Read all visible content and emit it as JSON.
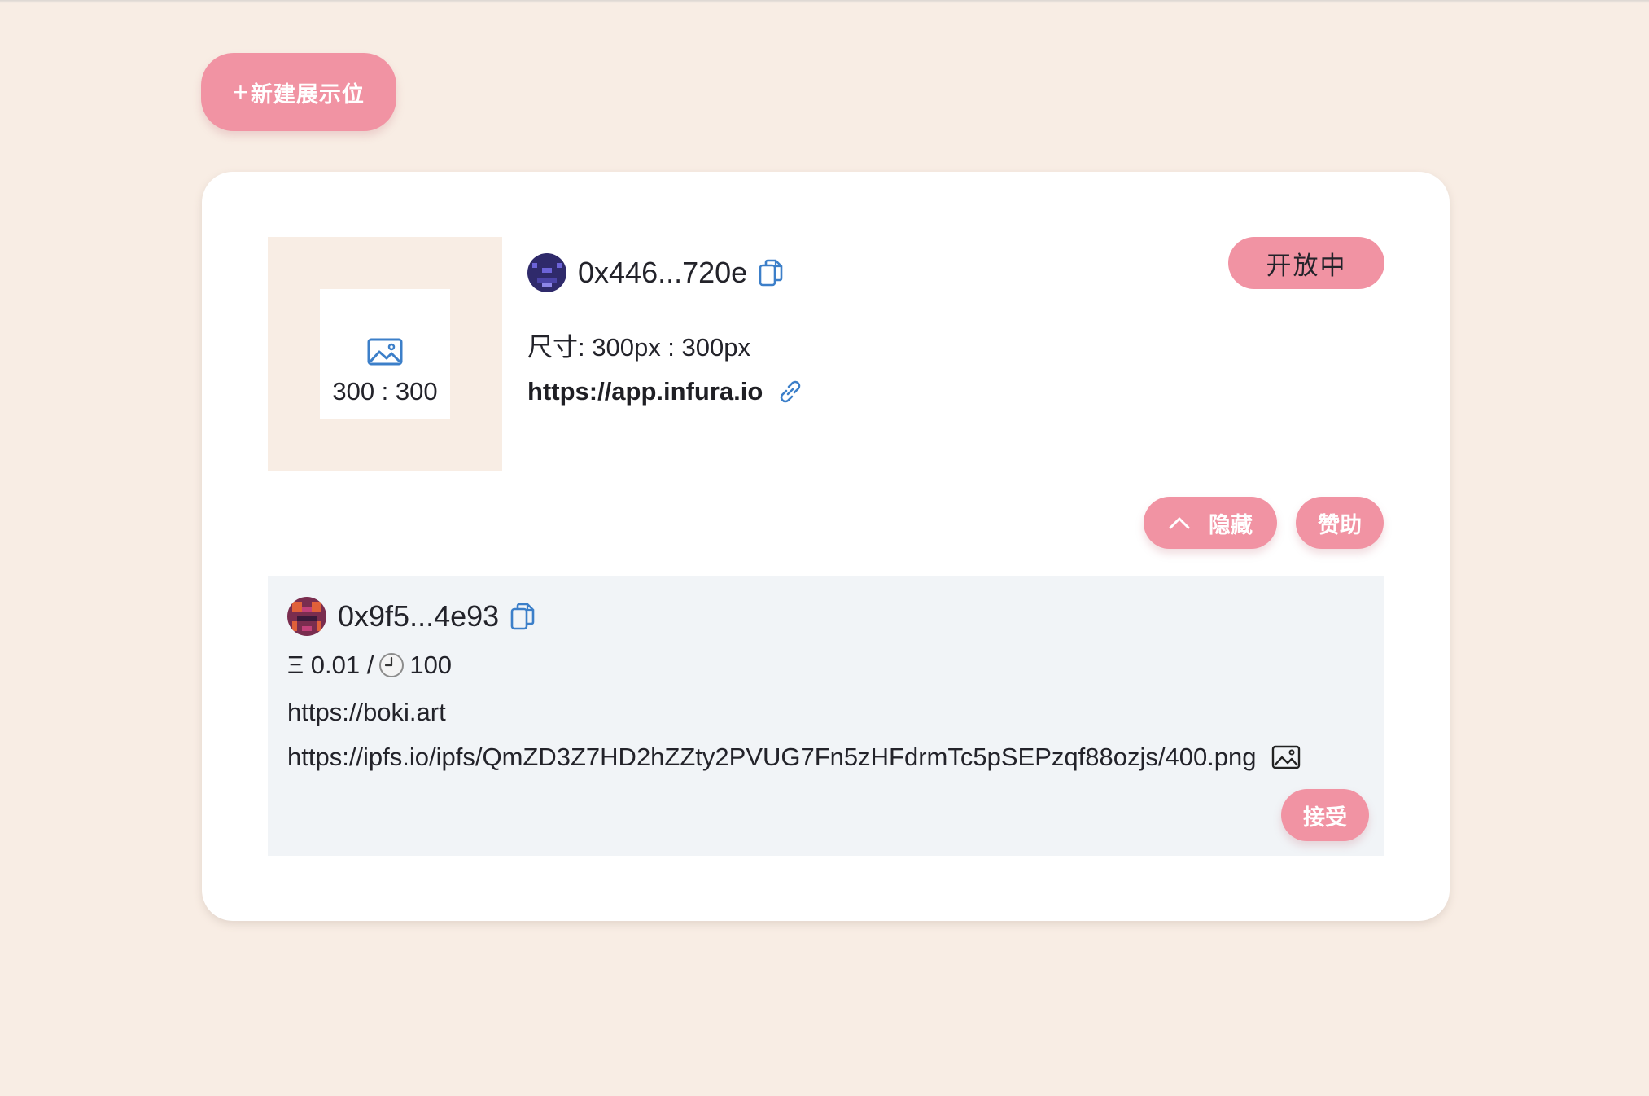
{
  "toolbar": {
    "new_slot_label": "新建展示位",
    "new_slot_icon": "plus-icon"
  },
  "slot": {
    "thumbnail": {
      "ratio_text": "300 : 300",
      "icon": "image-icon"
    },
    "owner": {
      "address": "0x446...720e",
      "avatar": "identicon-avatar",
      "copy_icon": "copy-icon"
    },
    "size_text": "尺寸: 300px : 300px",
    "link": {
      "text": "https://app.infura.io",
      "icon": "link-icon"
    },
    "status": "开放中",
    "actions": {
      "hide_label": "隐藏",
      "hide_icon": "chevron-up-icon",
      "sponsor_label": "赞助"
    }
  },
  "offer": {
    "bidder": {
      "address": "0x9f5...4e93",
      "avatar": "identicon-avatar",
      "copy_icon": "copy-icon"
    },
    "price_prefix": "Ξ 0.01 /",
    "duration": "100",
    "duration_icon": "clock-icon",
    "url": "https://boki.art",
    "image_url": "https://ipfs.io/ipfs/QmZD3Z7HD2hZZty2PVUG7Fn5zHFdrmTc5pSEPzqf88ozjs/400.png",
    "image_icon": "image-icon",
    "accept_label": "接受"
  },
  "colors": {
    "background": "#f8ede4",
    "accent": "#f193a3",
    "card": "#ffffff",
    "offer_panel": "#f1f4f7",
    "icon_blue": "#3c7fc9"
  }
}
